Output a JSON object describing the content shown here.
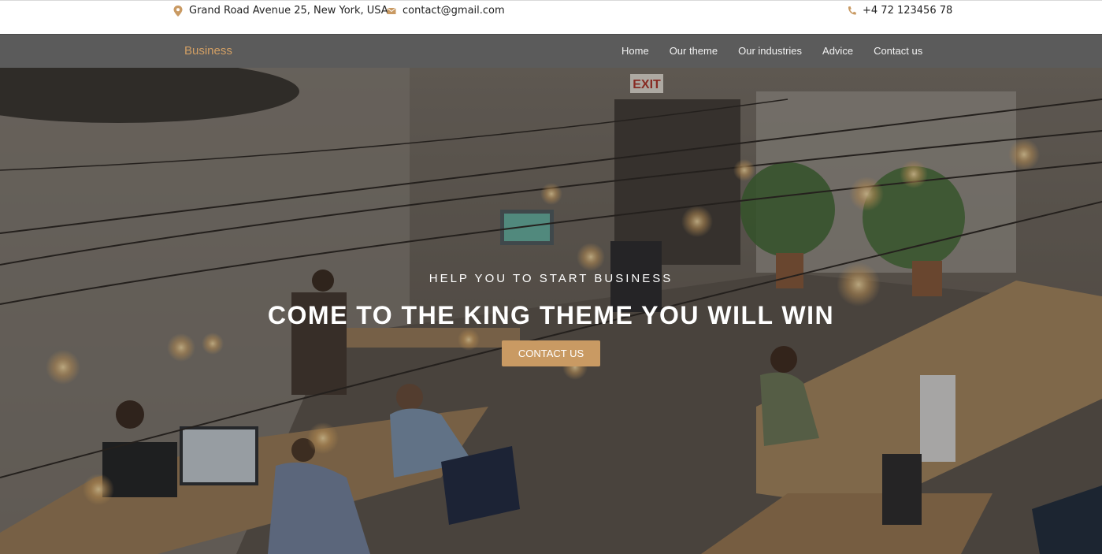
{
  "topbar": {
    "address": "Grand Road Avenue 25, New York, USA",
    "email": "contact@gmail.com",
    "phone": "+4 72 123456 78",
    "icon_color": "#c99a63"
  },
  "navbar": {
    "brand": "Business",
    "links": [
      "Home",
      "Our theme",
      "Our industries",
      "Advice",
      "Contact us"
    ],
    "brand_color": "#d29f64",
    "background": "#5b5b5b"
  },
  "hero": {
    "subtitle": "HELP YOU TO START BUSINESS",
    "title": "COME TO THE KING THEME YOU WILL WIN",
    "cta_label": "CONTACT US",
    "cta_color": "#c99a63",
    "image_description_icon": "office-coworking-photo",
    "sign": "EXIT"
  }
}
